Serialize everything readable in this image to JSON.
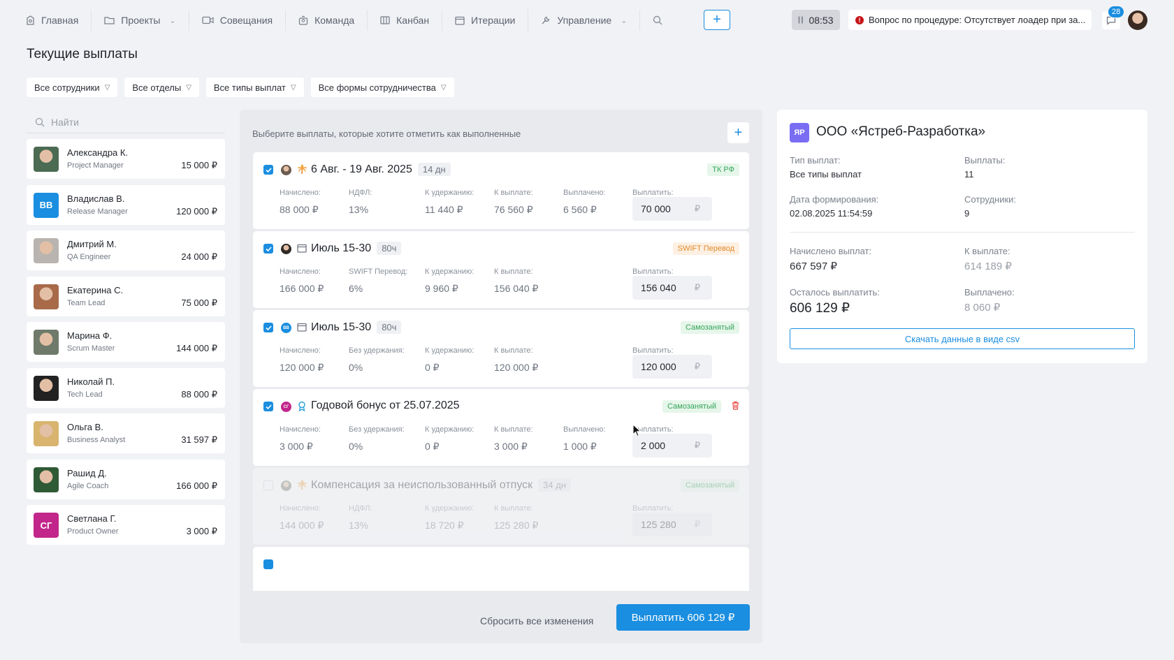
{
  "nav": {
    "items": [
      {
        "label": "Главная",
        "icon": "home-icon"
      },
      {
        "label": "Проекты",
        "icon": "folder-icon",
        "dropdown": true
      },
      {
        "label": "Совещания",
        "icon": "video-icon"
      },
      {
        "label": "Команда",
        "icon": "team-icon"
      },
      {
        "label": "Канбан",
        "icon": "kanban-icon"
      },
      {
        "label": "Итерации",
        "icon": "calendar-icon"
      },
      {
        "label": "Управление",
        "icon": "wrench-icon",
        "dropdown": true
      }
    ],
    "add_label": "+",
    "timer": "08:53",
    "notice": "Вопрос по процедуре: Отсутствует лоадер при за...",
    "chat_count": "28"
  },
  "page": {
    "title": "Текущие выплаты"
  },
  "filters": [
    "Все сотрудники",
    "Все отделы",
    "Все типы выплат",
    "Все формы сотрудничества"
  ],
  "search": {
    "placeholder": "Найти"
  },
  "employees": [
    {
      "name": "Александра К.",
      "role": "Project Manager",
      "amount": "15 000 ₽",
      "color": "#4b6b52"
    },
    {
      "name": "Владислав В.",
      "role": "Release Manager",
      "amount": "120 000 ₽",
      "initials": "ВВ",
      "color": "#1a8ee0"
    },
    {
      "name": "Дмитрий М.",
      "role": "QA Engineer",
      "amount": "24 000 ₽",
      "color": "#b9b4b0"
    },
    {
      "name": "Екатерина С.",
      "role": "Team Lead",
      "amount": "75 000 ₽",
      "color": "#a86a48"
    },
    {
      "name": "Марина Ф.",
      "role": "Scrum Master",
      "amount": "144 000 ₽",
      "color": "#6f7a6a"
    },
    {
      "name": "Николай П.",
      "role": "Tech Lead",
      "amount": "88 000 ₽",
      "color": "#222222"
    },
    {
      "name": "Ольга В.",
      "role": "Business Analyst",
      "amount": "31 597 ₽",
      "color": "#d8b46e"
    },
    {
      "name": "Рашид Д.",
      "role": "Agile Coach",
      "amount": "166 000 ₽",
      "color": "#2f5a36"
    },
    {
      "name": "Светлана Г.",
      "role": "Product Owner",
      "amount": "3 000 ₽",
      "initials": "СГ",
      "color": "#c2268a"
    }
  ],
  "payouts": {
    "hint": "Выберите выплаты, которые хотите отметить как выполненные",
    "cards": [
      {
        "title": "6 Авг. - 19 Авг. 2025",
        "duration": "14 дн",
        "type_icon": "palm-icon",
        "tag": "ТК РФ",
        "tag_kind": "tk",
        "checked": true,
        "ava_color": "#6b5a4e",
        "fields": [
          {
            "label": "Начислено:",
            "value": "88 000 ₽"
          },
          {
            "label": "НДФЛ:",
            "value": "13%"
          },
          {
            "label": "К удержанию:",
            "value": "11 440 ₽"
          },
          {
            "label": "К выплате:",
            "value": "76 560 ₽"
          },
          {
            "label": "Выплачено:",
            "value": "6 560 ₽"
          }
        ],
        "pay_label": "Выплатить:",
        "pay_value": "70 000"
      },
      {
        "title": "Июль 15-30",
        "duration": "80ч",
        "type_icon": "calendar-icon",
        "tag": "SWIFT Перевод",
        "tag_kind": "swift",
        "checked": true,
        "ava_color": "#2f2a26",
        "fields": [
          {
            "label": "Начислено:",
            "value": "166 000 ₽"
          },
          {
            "label": "SWIFT Перевод:",
            "value": "6%"
          },
          {
            "label": "К удержанию:",
            "value": "9 960 ₽"
          },
          {
            "label": "К выплате:",
            "value": "156 040 ₽"
          }
        ],
        "pay_label": "Выплатить:",
        "pay_value": "156 040"
      },
      {
        "title": "Июль 15-30",
        "duration": "80ч",
        "type_icon": "calendar-icon",
        "tag": "Самозанятый",
        "tag_kind": "self",
        "checked": true,
        "ava_color": "#1a8ee0",
        "ava_initials": "ВВ",
        "fields": [
          {
            "label": "Начислено:",
            "value": "120 000 ₽"
          },
          {
            "label": "Без удержания:",
            "value": "0%"
          },
          {
            "label": "К удержанию:",
            "value": "0 ₽"
          },
          {
            "label": "К выплате:",
            "value": "120 000 ₽"
          }
        ],
        "pay_label": "Выплатить:",
        "pay_value": "120 000"
      },
      {
        "title": "Годовой бонус от 25.07.2025",
        "duration": "",
        "type_icon": "award-icon",
        "tag": "Самозанятый",
        "tag_kind": "self",
        "checked": true,
        "ava_color": "#c2268a",
        "ava_initials": "СГ",
        "deletable": true,
        "fields": [
          {
            "label": "Начислено:",
            "value": "3 000 ₽"
          },
          {
            "label": "Без удержания:",
            "value": "0%"
          },
          {
            "label": "К удержанию:",
            "value": "0 ₽"
          },
          {
            "label": "К выплате:",
            "value": "3 000 ₽"
          },
          {
            "label": "Выплачено:",
            "value": "1 000 ₽"
          }
        ],
        "pay_label": "Выплатить:",
        "pay_value": "2 000"
      },
      {
        "title": "Компенсация за неиспользованный отпуск",
        "duration": "34 дн",
        "type_icon": "palm-icon",
        "tag": "Самозанятый",
        "tag_kind": "self",
        "checked": false,
        "disabled": true,
        "ava_color": "#6f7a6a",
        "fields": [
          {
            "label": "Начислено:",
            "value": "144 000 ₽"
          },
          {
            "label": "НДФЛ:",
            "value": "13%"
          },
          {
            "label": "К удержанию:",
            "value": "18 720 ₽"
          },
          {
            "label": "К выплате:",
            "value": "125 280 ₽"
          }
        ],
        "pay_label": "Выплатить:",
        "pay_value": "125 280"
      }
    ],
    "reset_label": "Сбросить все изменения",
    "pay_button": "Выплатить 606 129 ₽",
    "add_label": "+"
  },
  "company": {
    "logo": "ЯР",
    "name": "ООО «Ястреб-Разработка»",
    "type_label": "Тип выплат:",
    "type_value": "Все типы выплат",
    "count_label": "Выплаты:",
    "count_value": "11",
    "date_label": "Дата формирования:",
    "date_value": "02.08.2025 11:54:59",
    "staff_label": "Сотрудники:",
    "staff_value": "9",
    "accrued_label": "Начислено выплат:",
    "accrued_value": "667 597 ₽",
    "topay_label": "К выплате:",
    "topay_value": "614 189 ₽",
    "left_label": "Осталось выплатить:",
    "left_value": "606 129 ₽",
    "paid_label": "Выплачено:",
    "paid_value": "8 060 ₽",
    "csv_label": "Скачать данные в виде csv"
  },
  "colors": {
    "accent": "#1a8ee0",
    "danger": "#e8403c",
    "success": "#35a55a",
    "warning": "#e08a2c"
  }
}
